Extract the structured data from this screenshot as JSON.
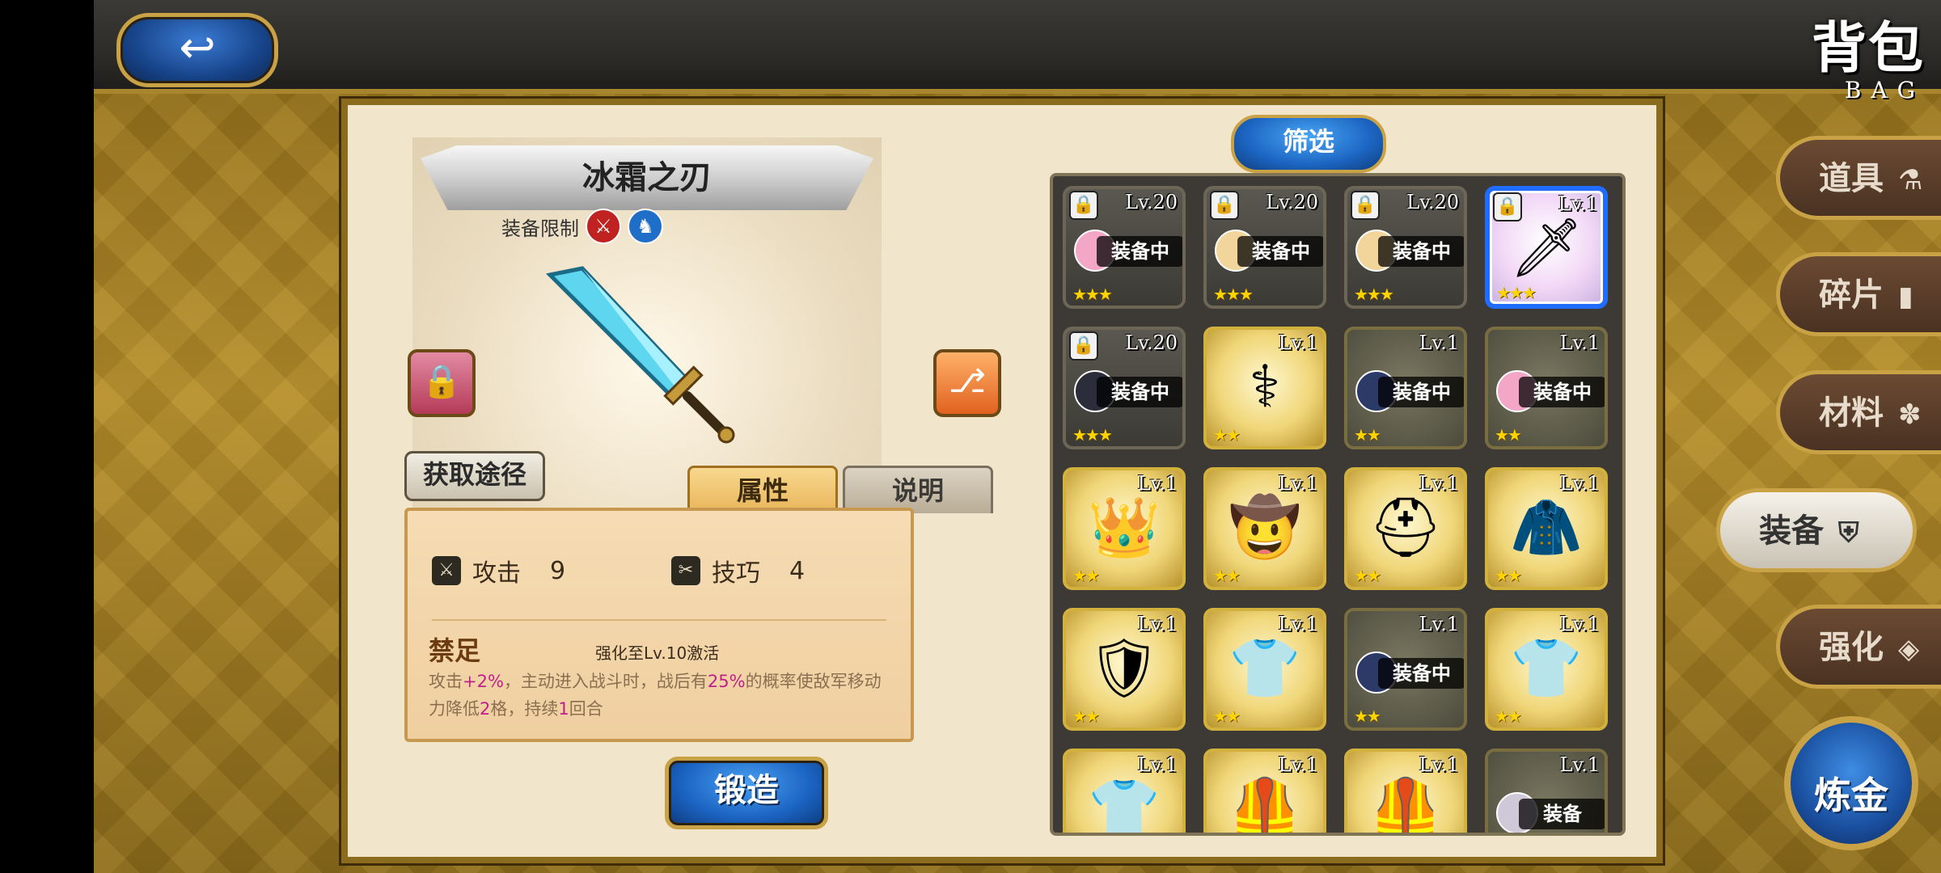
{
  "header": {
    "back_icon": "↩",
    "title": "背包",
    "title_en": "BAG"
  },
  "detail": {
    "item_name": "冰霜之刃",
    "restrict_label": "装备限制",
    "restrict_icons": [
      "sword-class-icon",
      "horse-class-icon"
    ],
    "source_button": "获取途径",
    "tabs": {
      "attr": "属性",
      "desc": "说明"
    },
    "stats": [
      {
        "name": "攻击",
        "value": "9"
      },
      {
        "name": "技巧",
        "value": "4"
      }
    ],
    "skill": {
      "name": "禁足",
      "condition": "强化至Lv.10激活",
      "desc_parts": [
        "攻击",
        "+2%",
        "，主动进入战斗时，战后有",
        "25%",
        "的概率使敌军移动力降低",
        "2",
        "格，持续",
        "1",
        "回合"
      ]
    },
    "forge_button": "锻造"
  },
  "filter_button": "筛选",
  "equipped_label": "装备中",
  "slots": [
    {
      "lvl": "Lv.20",
      "locked": true,
      "equipped": true,
      "stars": "★★★",
      "style": "dark",
      "avatar": "#f3a6c6"
    },
    {
      "lvl": "Lv.20",
      "locked": true,
      "equipped": true,
      "stars": "★★★",
      "style": "dark",
      "avatar": "#f2d59a"
    },
    {
      "lvl": "Lv.20",
      "locked": true,
      "equipped": true,
      "stars": "★★★",
      "style": "dark",
      "avatar": "#f2d59a"
    },
    {
      "lvl": "Lv.1",
      "locked": true,
      "equipped": false,
      "stars": "★★★",
      "style": "selected",
      "glyph": "🗡"
    },
    {
      "lvl": "Lv.20",
      "locked": true,
      "equipped": true,
      "stars": "★★★",
      "style": "dark",
      "avatar": "#2b2d3a"
    },
    {
      "lvl": "Lv.1",
      "locked": false,
      "equipped": false,
      "stars": "★★",
      "style": "gold",
      "glyph": "⚕"
    },
    {
      "lvl": "Lv.1",
      "locked": false,
      "equipped": true,
      "stars": "★★",
      "style": "dim",
      "avatar": "#2c3a68"
    },
    {
      "lvl": "Lv.1",
      "locked": false,
      "equipped": true,
      "stars": "★★",
      "style": "dim",
      "avatar": "#f3a6c6"
    },
    {
      "lvl": "Lv.1",
      "locked": false,
      "equipped": false,
      "stars": "★★",
      "style": "gold",
      "glyph": "👑"
    },
    {
      "lvl": "Lv.1",
      "locked": false,
      "equipped": false,
      "stars": "★★",
      "style": "gold",
      "glyph": "🤠"
    },
    {
      "lvl": "Lv.1",
      "locked": false,
      "equipped": false,
      "stars": "★★",
      "style": "gold",
      "glyph": "⛑"
    },
    {
      "lvl": "Lv.1",
      "locked": false,
      "equipped": false,
      "stars": "★★",
      "style": "gold",
      "glyph": "🧥"
    },
    {
      "lvl": "Lv.1",
      "locked": false,
      "equipped": false,
      "stars": "★★",
      "style": "gold",
      "glyph": "🛡"
    },
    {
      "lvl": "Lv.1",
      "locked": false,
      "equipped": false,
      "stars": "★★",
      "style": "gold",
      "glyph": "👕"
    },
    {
      "lvl": "Lv.1",
      "locked": false,
      "equipped": true,
      "stars": "★★",
      "style": "dim",
      "avatar": "#2c3a68"
    },
    {
      "lvl": "Lv.1",
      "locked": false,
      "equipped": false,
      "stars": "★★",
      "style": "gold",
      "glyph": "👕"
    },
    {
      "lvl": "Lv.1",
      "locked": false,
      "equipped": false,
      "stars": "",
      "style": "gold",
      "glyph": "👕"
    },
    {
      "lvl": "Lv.1",
      "locked": false,
      "equipped": false,
      "stars": "",
      "style": "gold",
      "glyph": "🦺"
    },
    {
      "lvl": "Lv.1",
      "locked": false,
      "equipped": false,
      "stars": "",
      "style": "gold",
      "glyph": "🦺"
    },
    {
      "lvl": "Lv.1",
      "locked": false,
      "equipped": true,
      "stars": "",
      "style": "dim",
      "avatar": "#cfc8d8",
      "equipped_text": "装备"
    }
  ],
  "side_nav": [
    {
      "label": "道具",
      "icon": "⚗"
    },
    {
      "label": "碎片",
      "icon": "▮"
    },
    {
      "label": "材料",
      "icon": "✽"
    },
    {
      "label": "装备",
      "icon": "⛨"
    },
    {
      "label": "强化",
      "icon": "◈"
    }
  ],
  "alchemy_button": "炼金",
  "colors": {
    "accent_gold": "#c9a246",
    "button_blue": "#1c65c2",
    "highlight_pink": "#c0208a",
    "selected_blue": "#1f6cff"
  }
}
